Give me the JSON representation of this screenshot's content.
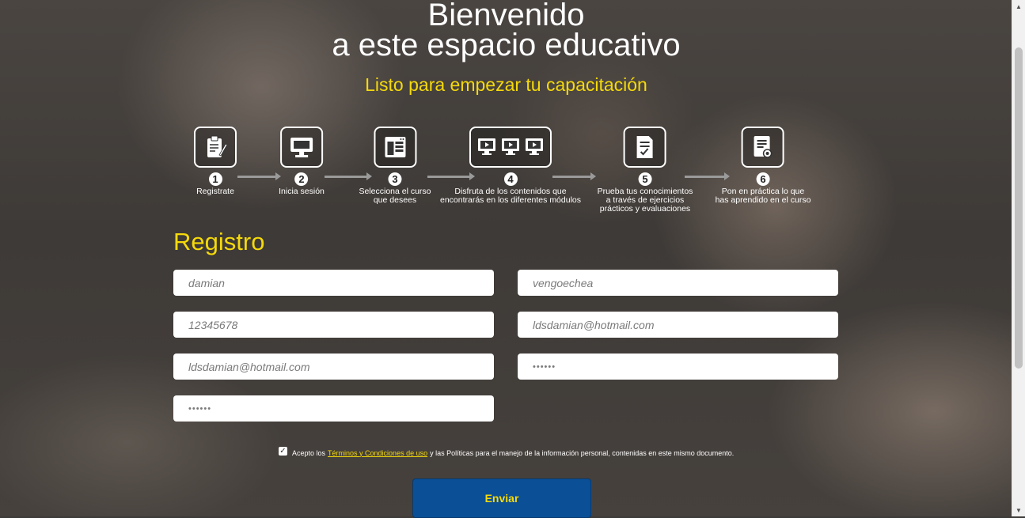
{
  "header": {
    "title_line1": "Bienvenido",
    "title_line2": "a este espacio educativo",
    "subtitle": "Listo para empezar tu capacitación"
  },
  "steps": [
    {
      "number": "1",
      "label": "Registrate",
      "icon": "clipboard-icon"
    },
    {
      "number": "2",
      "label": "Inicia sesión",
      "icon": "monitor-icon"
    },
    {
      "number": "3",
      "label": "Selecciona el curso\nque desees",
      "icon": "browser-window-icon"
    },
    {
      "number": "4",
      "label": "Disfruta de los contenidos que\nencontrarás en los diferentes módulos",
      "icon": "modules-icon"
    },
    {
      "number": "5",
      "label": "Prueba tus conocimientos\na través de ejercicios\nprácticos y evaluaciones",
      "icon": "exam-icon"
    },
    {
      "number": "6",
      "label": "Pon en práctica lo que\nhas aprendido en el curso",
      "icon": "certificate-icon"
    }
  ],
  "form": {
    "heading": "Registro",
    "fields": {
      "first_name": "damian",
      "last_name": "vengoechea",
      "document": "12345678",
      "email": "ldsdamian@hotmail.com",
      "email_confirm": "ldsdamian@hotmail.com",
      "password": "••••••",
      "password_confirm": "••••••"
    },
    "terms": {
      "checked": true,
      "prefix": "Acepto los",
      "link": "Términos y Condiciones de uso",
      "suffix": "y las Políticas para el manejo de la información personal, contenidas en este mismo documento."
    },
    "submit_label": "Enviar"
  },
  "colors": {
    "accent_yellow": "#f5d90a",
    "button_blue": "#0b4f96"
  }
}
